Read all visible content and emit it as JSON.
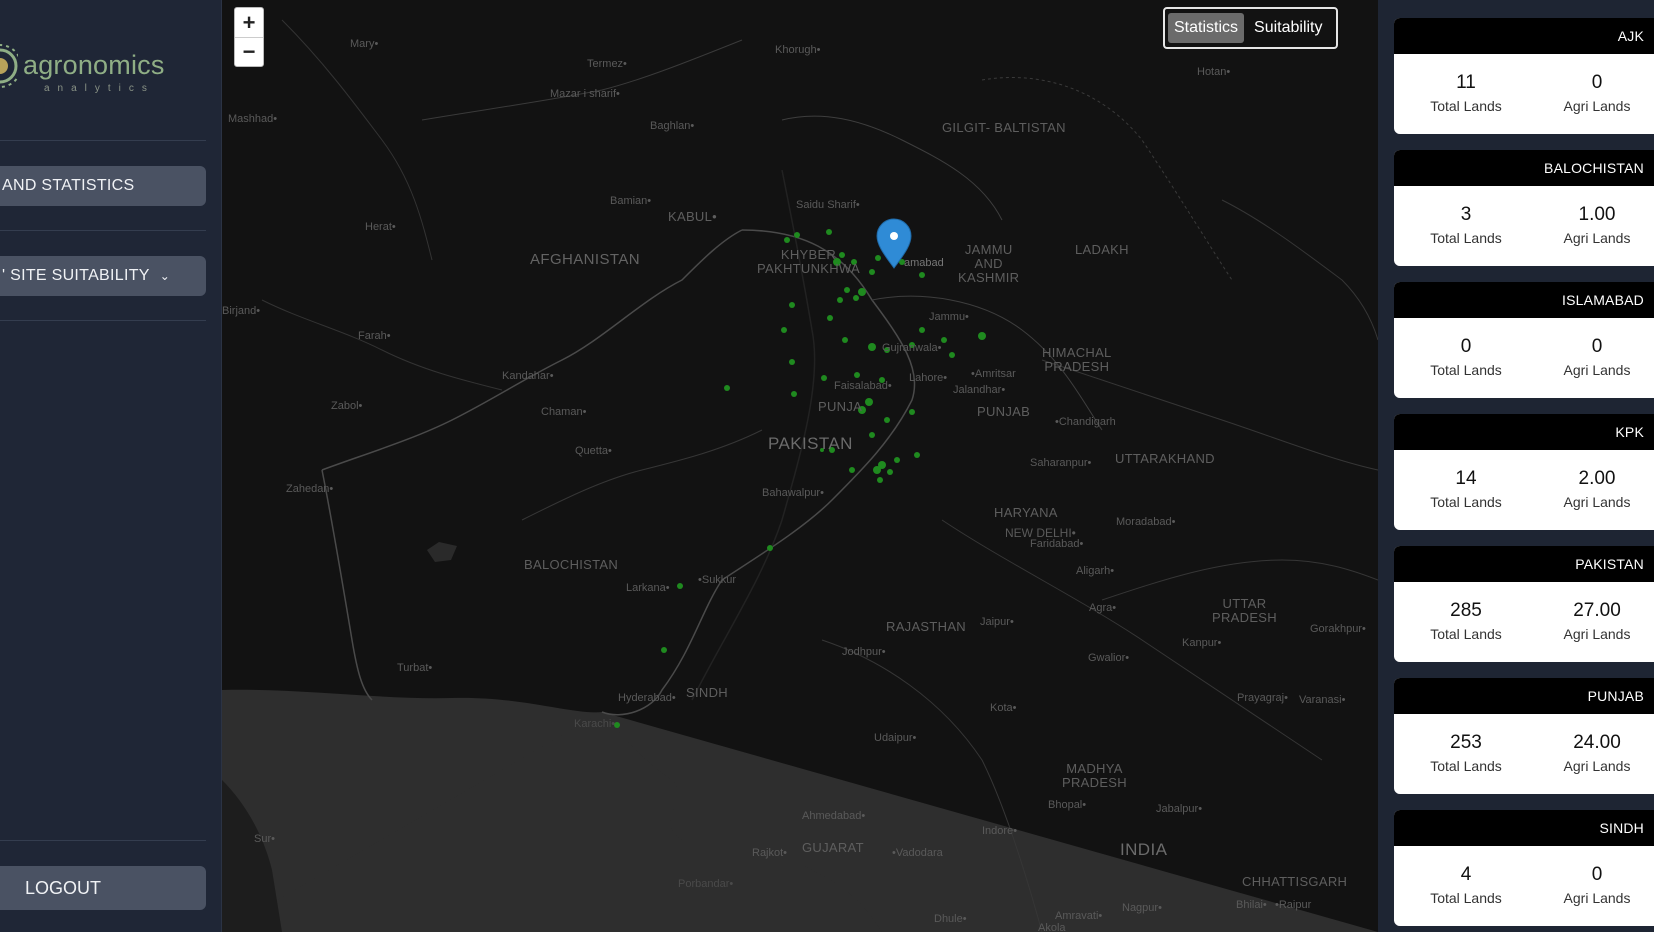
{
  "logo": {
    "word": "agronomics",
    "sub": "analytics"
  },
  "nav": {
    "land_statistics": "AND STATISTICS",
    "site_suitability": "' SITE SUITABILITY",
    "logout": "LOGOUT"
  },
  "map": {
    "zoom_in": "+",
    "zoom_out": "−",
    "toggle": {
      "statistics": "Statistics",
      "suitability": "Suitability",
      "active": "Statistics"
    },
    "labels": {
      "mary": "Mary•",
      "termez": "Termez•",
      "khorugh": "Khorugh•",
      "hotan": "Hotan•",
      "mashhad": "Mashhad•",
      "mazar": "Mazar i sharif•",
      "baghlan": "Baghlan•",
      "gilgit": "GILGIT-\nBALTISTAN",
      "bamian": "Bamian•",
      "kabul": "KABUL•",
      "saidu": "Saidu Sharif•",
      "herat": "Herat•",
      "afghanistan": "AFGHANISTAN",
      "kp": "KHYBER\nPAKHTUNKHWA",
      "islamabad": "amabad",
      "jk": "JAMMU\nAND\nKASHMIR",
      "ladakh": "LADAKH",
      "birjand": "Birjand•",
      "jammu": "Jammu•",
      "farah": "Farah•",
      "gujranwala": "Gujranwala•",
      "hp": "HIMACHAL\nPRADESH",
      "kandahar": "Kandahar•",
      "amritsar": "•Amritsar",
      "faisalabad": "Faisalabad•",
      "lahore": "Lahore•",
      "jalandhar": "Jalandhar•",
      "zabol": "Zabol•",
      "punjab_pk": "PUNJA",
      "punjab_in": "PUNJAB",
      "chaman": "Chaman•",
      "chandigarh": "•Chandigarh",
      "pakistan": "PAKISTAN",
      "quetta": "Quetta•",
      "saharanpur": "Saharanpur•",
      "uttarakhand": "UTTARAKHAND",
      "zahedan": "Zahedan•",
      "bahawalpur": "Bahawalpur•",
      "haryana": "HARYANA",
      "moradabad": "Moradabad•",
      "delhi": "NEW DELHI•",
      "faridabad": "Faridabad•",
      "balochistan": "BALOCHISTAN",
      "aligarh": "Aligarh•",
      "larkana": "Larkana•",
      "sukkur": "•Sukkur",
      "agra": "Agra•",
      "up": "UTTAR\nPRADESH",
      "rajasthan": "RAJASTHAN",
      "jaipur": "Jaipur•",
      "gorakhpur": "Gorakhpur•",
      "kanpur": "Kanpur•",
      "jodhpur": "Jodhpur•",
      "turbat": "Turbat•",
      "gwalior": "Gwalior•",
      "hyderabad": "Hyderabad•",
      "sindh": "SINDH",
      "prayagraj": "Prayagraj•",
      "varanasi": "Varanasi•",
      "kota": "Kota•",
      "karachi": "Karachi•",
      "udaipur": "Udaipur•",
      "mp": "MADHYA\nPRADESH",
      "bhopal": "Bhopal•",
      "jabalpur": "Jabalpur•",
      "ahmedabad": "Ahmedabad•",
      "indore": "Indore•",
      "sur": "Sur•",
      "gujarat": "GUJARAT",
      "rajkot": "Rajkot•",
      "vadodara": "•Vadodara",
      "india": "INDIA",
      "chhattisgarh": "CHHATTISGARH",
      "porbandar": "Porbandar•",
      "nagpur": "Nagpur•",
      "bhilai": "Bhilai•",
      "raipur": "•Raipur",
      "dhule": "Dhule•",
      "amravati": "Amravati•",
      "akola": "Akola"
    }
  },
  "regions": [
    {
      "name": "AJK",
      "total_lands": "11",
      "agri_lands": "0"
    },
    {
      "name": "BALOCHISTAN",
      "total_lands": "3",
      "agri_lands": "1.00"
    },
    {
      "name": "ISLAMABAD",
      "total_lands": "0",
      "agri_lands": "0"
    },
    {
      "name": "KPK",
      "total_lands": "14",
      "agri_lands": "2.00"
    },
    {
      "name": "PAKISTAN",
      "total_lands": "285",
      "agri_lands": "27.00"
    },
    {
      "name": "PUNJAB",
      "total_lands": "253",
      "agri_lands": "24.00"
    },
    {
      "name": "SINDH",
      "total_lands": "4",
      "agri_lands": "0"
    }
  ],
  "stat_labels": {
    "total": "Total Lands",
    "agri": "Agri Lands"
  },
  "colors": {
    "sidebar": "#1f2636",
    "button": "#4a5263",
    "map_bg": "#121212",
    "point": "#1f8a1f",
    "marker": "#2f8bd6",
    "card_head": "#000000"
  }
}
